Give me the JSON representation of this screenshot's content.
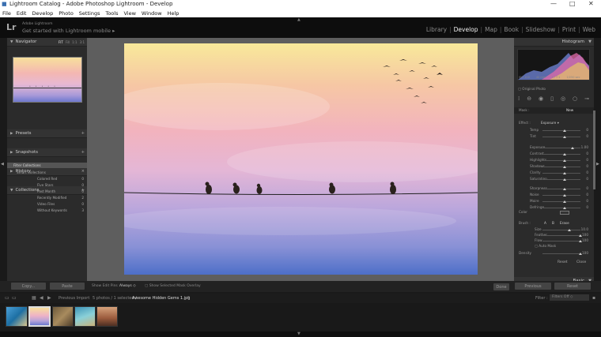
{
  "window": {
    "title": "Lightroom Catalog - Adobe Photoshop Lightroom - Develop",
    "controls": {
      "minimize": "—",
      "maximize": "□",
      "close": "✕"
    }
  },
  "menu": [
    "File",
    "Edit",
    "Develop",
    "Photo",
    "Settings",
    "Tools",
    "View",
    "Window",
    "Help"
  ],
  "header": {
    "logo": "Lr",
    "catalog_label": "Adobe Lightroom",
    "mobile_label": "Get started with Lightroom mobile",
    "modules": [
      "Library",
      "Develop",
      "Map",
      "Book",
      "Slideshow",
      "Print",
      "Web"
    ],
    "active_module": "Develop"
  },
  "left_panel": {
    "navigator": {
      "label": "Navigator",
      "zooms": [
        "FIT",
        "Fill",
        "1:1",
        "3:1"
      ]
    },
    "presets": "Presets",
    "snapshots": "Snapshots",
    "history": "History",
    "collections": "Collections",
    "collection_items": [
      {
        "label": "Filter Collections",
        "count": ""
      },
      {
        "label": "Smart Collections",
        "count": ""
      },
      {
        "label": "Colored Red",
        "count": "0"
      },
      {
        "label": "Five Stars",
        "count": "0"
      },
      {
        "label": "Past Month",
        "count": "0"
      },
      {
        "label": "Recently Modified",
        "count": "2"
      },
      {
        "label": "Video Files",
        "count": "0"
      },
      {
        "label": "Without Keywords",
        "count": "3"
      }
    ]
  },
  "right_panel": {
    "histogram_label": "Histogram",
    "histo_readouts": [
      "ISO 100",
      "40 mm",
      "f / 7.1",
      "1/250 sec"
    ],
    "original_photo": "Original Photo",
    "mask_label": "Mask :",
    "mask_value": "New",
    "effect_label": "Effect :",
    "effect_value": "Exposure",
    "sliders": [
      {
        "label": "Temp",
        "value": "0"
      },
      {
        "label": "Tint",
        "value": "0"
      },
      {
        "label": "Exposure",
        "value": "1.00"
      },
      {
        "label": "Contrast",
        "value": "0"
      },
      {
        "label": "Highlights",
        "value": "0"
      },
      {
        "label": "Shadows",
        "value": "0"
      },
      {
        "label": "Clarity",
        "value": "0"
      },
      {
        "label": "Saturation",
        "value": "0"
      },
      {
        "label": "Sharpness",
        "value": "0"
      },
      {
        "label": "Noise",
        "value": "0"
      },
      {
        "label": "Moire",
        "value": "0"
      },
      {
        "label": "Defringe",
        "value": "0"
      }
    ],
    "color_label": "Color",
    "brush_label": "Brush :",
    "brush_tabs": [
      "A",
      "B",
      "Erase"
    ],
    "brush_sliders": [
      {
        "label": "Size",
        "value": "10.0"
      },
      {
        "label": "Feather",
        "value": "100"
      },
      {
        "label": "Flow",
        "value": "100"
      }
    ],
    "auto_mask": "Auto Mask",
    "density_label": "Density",
    "density_value": "100",
    "reset": "Reset",
    "close": "Close",
    "basic": "Basic",
    "previous": "Previous",
    "reset_button": "Reset"
  },
  "toolbar": {
    "copy": "Copy...",
    "paste": "Paste",
    "show_edit_pins": "Show Edit Pins :",
    "always": "Always",
    "show_mask_overlay": "Show Selected Mask Overlay",
    "done": "Done"
  },
  "filmstrip_bar": {
    "pages": [
      "1",
      "2"
    ],
    "source": "Previous Import",
    "count": "5 photos / 1 selected /",
    "filename": "Awesome Hidden Gems 1.jpg",
    "filter_label": "Filter :",
    "filter_value": "Filters Off"
  },
  "colors": {
    "accent": "#eeeeee",
    "panel": "#2b2b2b",
    "canvas": "#5e5e5e"
  }
}
